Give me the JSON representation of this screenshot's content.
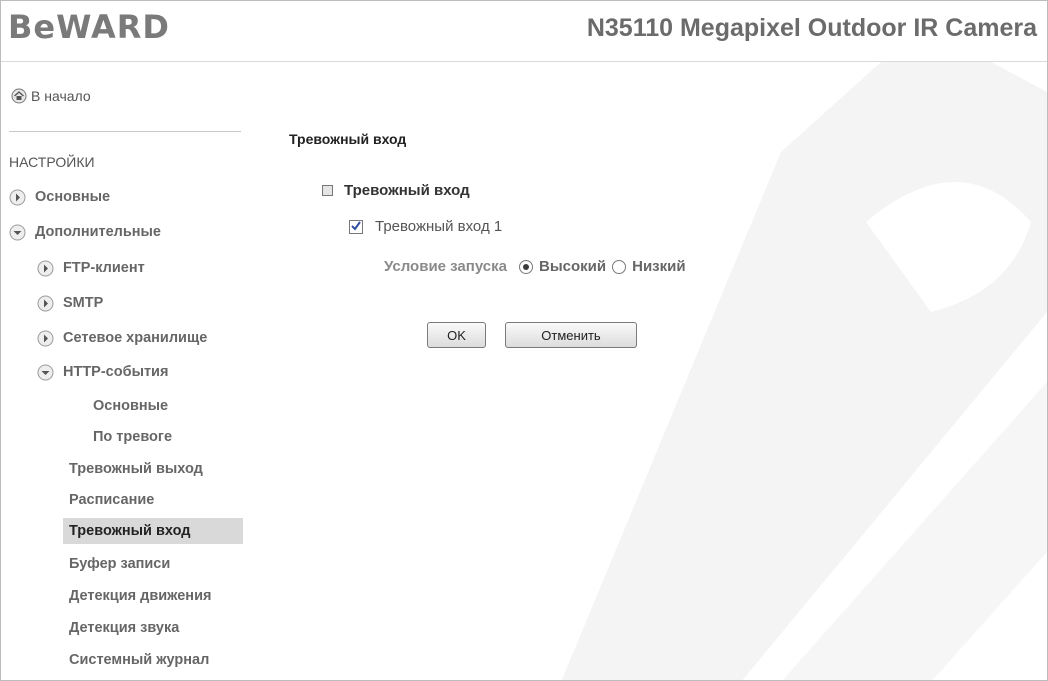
{
  "header": {
    "logo_text": "BeWARD",
    "product_title": "N35110 Megapixel Outdoor IR Camera"
  },
  "sidebar": {
    "home_label": "В начало",
    "section_title": "НАСТРОЙКИ",
    "items": [
      {
        "label": "Основные",
        "arrow": "right"
      },
      {
        "label": "Дополнительные",
        "arrow": "down"
      },
      {
        "label": "FTP-клиент",
        "arrow": "right"
      },
      {
        "label": "SMTP",
        "arrow": "right"
      },
      {
        "label": "Сетевое хранилище",
        "arrow": "right"
      },
      {
        "label": "HTTP-события",
        "arrow": "down"
      },
      {
        "label": "Основные"
      },
      {
        "label": "По тревоге"
      },
      {
        "label": "Тревожный выход"
      },
      {
        "label": "Расписание"
      },
      {
        "label": "Тревожный вход",
        "active": true
      },
      {
        "label": "Буфер записи"
      },
      {
        "label": "Детекция движения"
      },
      {
        "label": "Детекция звука"
      },
      {
        "label": "Системный журнал"
      }
    ]
  },
  "main": {
    "page_title": "Тревожный вход",
    "group_title": "Тревожный вход",
    "input1_label": "Тревожный вход 1",
    "input1_checked": true,
    "condition_label": "Условие запуска",
    "radio_high": "Высокий",
    "radio_low": "Низкий",
    "selected_condition": "Высокий",
    "ok_label": "OK",
    "cancel_label": "Отменить"
  },
  "icons": {
    "home": "home-icon",
    "arrow_right": "chevron-right-icon",
    "arrow_down": "chevron-down-icon"
  }
}
